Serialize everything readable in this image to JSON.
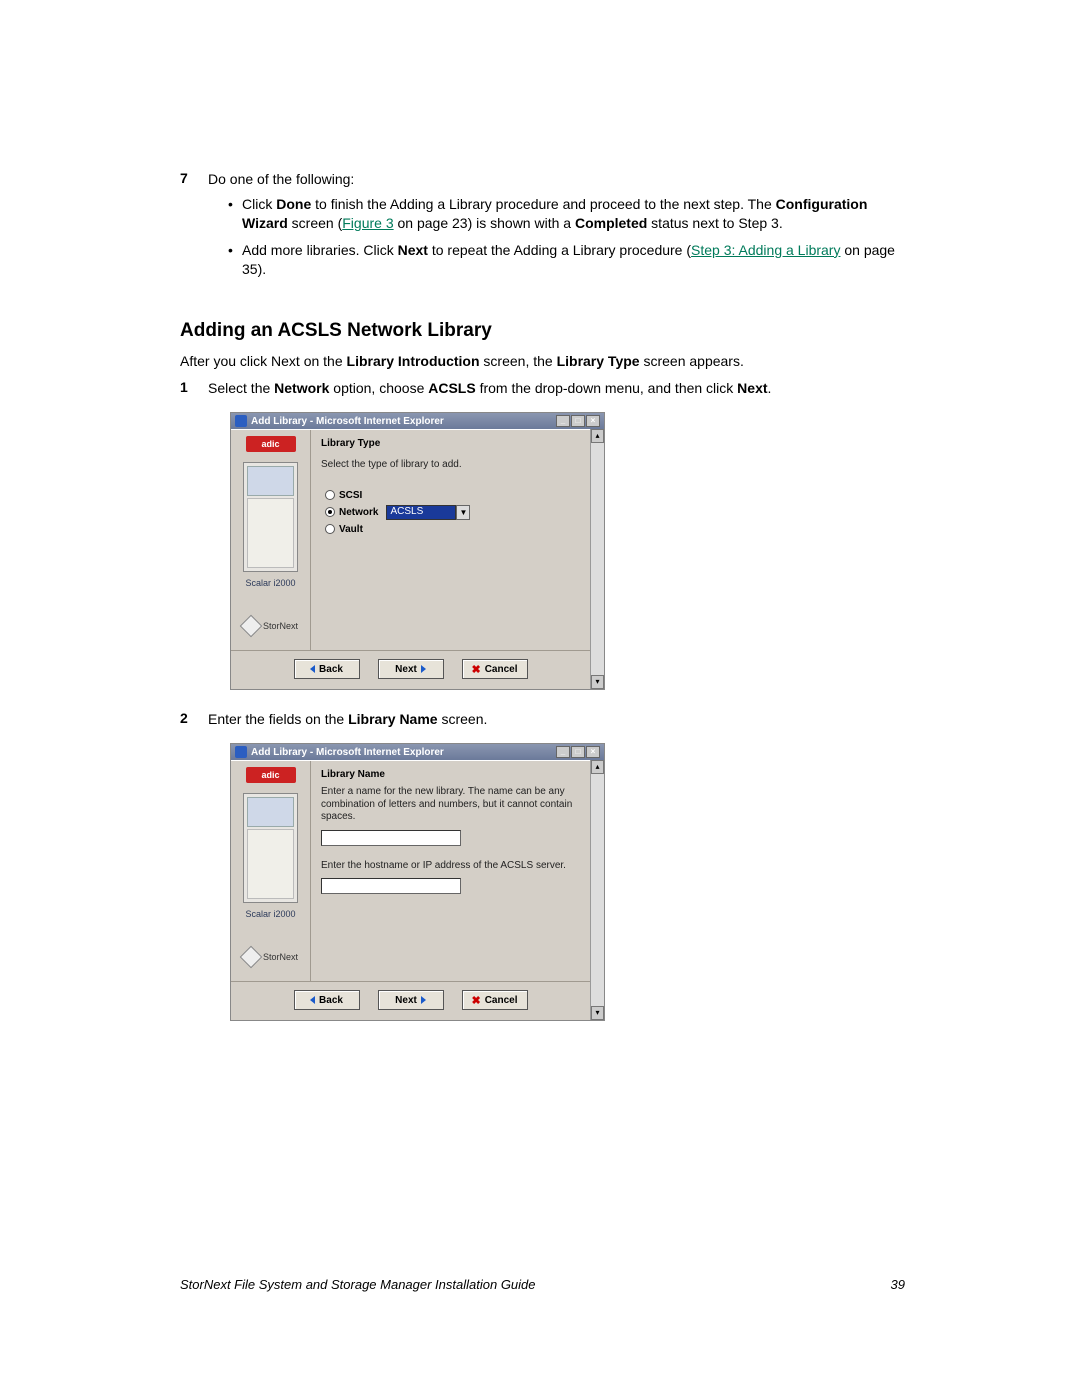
{
  "step7": {
    "num": "7",
    "intro": "Do one of the following:",
    "bullets": [
      {
        "pre": "Click ",
        "b1": "Done",
        "mid1": " to finish the Adding a Library procedure and proceed to the next step. The ",
        "b2": "Configuration Wizard",
        "mid2": " screen (",
        "link": "Figure 3",
        "mid3": " on page 23) is shown with a ",
        "b3": "Completed",
        "tail": " status next to Step 3."
      },
      {
        "pre": "Add more libraries. Click ",
        "b1": "Next",
        "mid1": " to repeat the Adding a Library procedure (",
        "link": "Step 3: Adding a Library",
        "tail": " on page 35)."
      }
    ]
  },
  "heading": "Adding an ACSLS Network Library",
  "intro": {
    "pre": "After you click Next on the ",
    "b1": "Library Introduction",
    "mid": " screen, the ",
    "b2": "Library Type",
    "tail": " screen appears."
  },
  "step1": {
    "num": "1",
    "pre": "Select the ",
    "b1": "Network",
    "mid1": " option, choose ",
    "b2": "ACSLS",
    "mid2": " from the drop-down menu, and then click ",
    "b3": "Next",
    "tail": "."
  },
  "dialog1": {
    "title": "Add Library - Microsoft Internet Explorer",
    "logo": "adic",
    "scalar": "Scalar i2000",
    "stornext": "StorNext",
    "head": "Library Type",
    "instr": "Select the type of library to add.",
    "opt_scsi": "SCSI",
    "opt_net": "Network",
    "combo": "ACSLS",
    "opt_vault": "Vault",
    "btn_back": "Back",
    "btn_next": "Next",
    "btn_cancel": "Cancel"
  },
  "step2": {
    "num": "2",
    "pre": "Enter the fields on the ",
    "b1": "Library Name",
    "tail": " screen."
  },
  "dialog2": {
    "title": "Add Library - Microsoft Internet Explorer",
    "logo": "adic",
    "scalar": "Scalar i2000",
    "stornext": "StorNext",
    "head": "Library Name",
    "instr1": "Enter a name for the new library. The name can be any combination of letters and numbers, but it cannot contain spaces.",
    "instr2": "Enter the hostname or IP address of the ACSLS server.",
    "btn_back": "Back",
    "btn_next": "Next",
    "btn_cancel": "Cancel"
  },
  "footer": {
    "title": "StorNext File System and Storage Manager Installation Guide",
    "page": "39"
  }
}
